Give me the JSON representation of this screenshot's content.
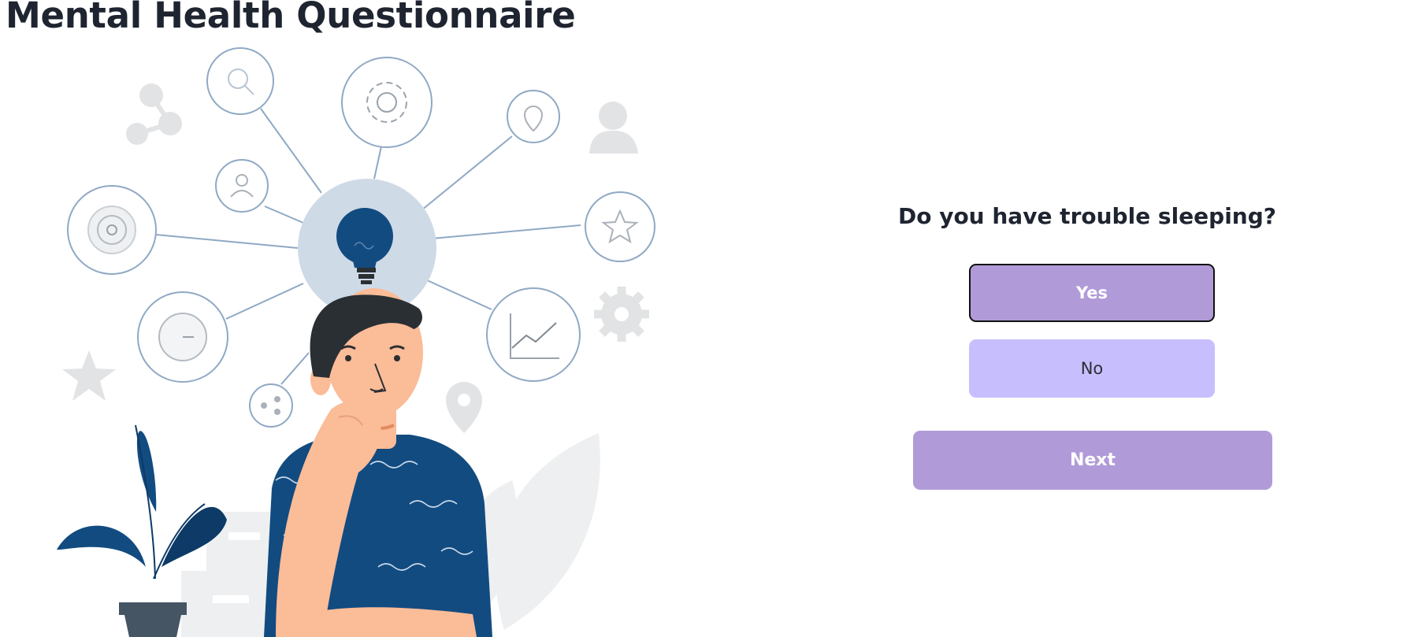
{
  "page": {
    "title": "Mental Health Questionnaire"
  },
  "illustration": {
    "icon": "thinking-person-illustration",
    "colors": {
      "navy": "#124b80",
      "skin": "#fbbc98",
      "hair": "#2a2f33",
      "node_ring": "#8fa9c4",
      "bulb_circle": "#cfdae7",
      "gray": "#e2e3e5"
    }
  },
  "quiz": {
    "question": "Do you have trouble sleeping?",
    "options": [
      {
        "label": "Yes",
        "selected": true
      },
      {
        "label": "No",
        "selected": false
      }
    ],
    "next_label": "Next"
  },
  "colors": {
    "button_purple": "#b09bd8",
    "option_lavender": "#c7bffd",
    "text_dark": "#1e2430"
  }
}
